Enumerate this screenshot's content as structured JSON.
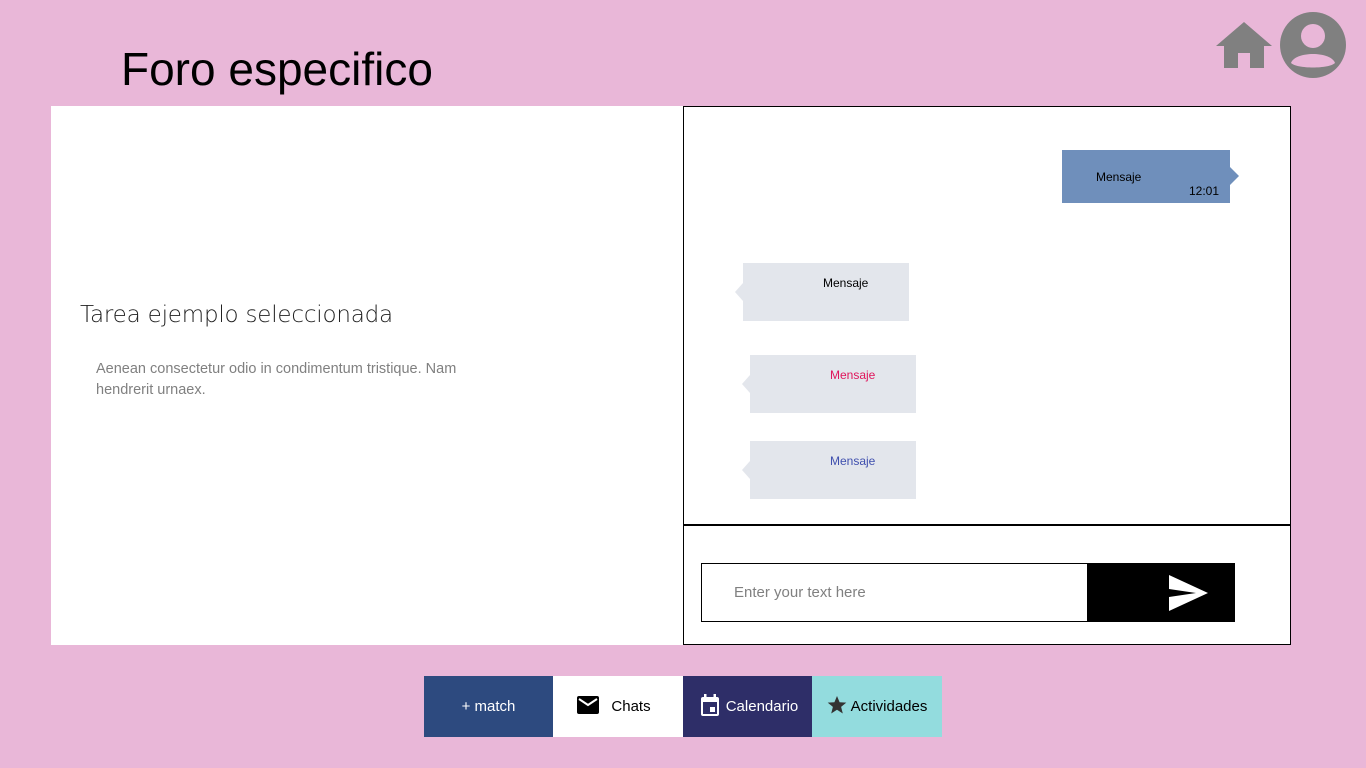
{
  "header": {
    "title": "Foro especifico",
    "icons": [
      "home-icon",
      "user-icon"
    ]
  },
  "task": {
    "title": "Tarea ejemplo seleccionada",
    "description": "Aenean consectetur odio in condimentum tristique. Nam hendrerit urnaex."
  },
  "chat": {
    "messages": [
      {
        "text": "Mensaje",
        "time": "12:01",
        "direction": "outgoing",
        "color": "#000000",
        "bg": "#6f8fbb"
      },
      {
        "text": "Mensaje",
        "direction": "incoming",
        "color": "#000000",
        "bg": "#e3e6ec"
      },
      {
        "text": "Mensaje",
        "direction": "incoming",
        "color": "#e0155b",
        "bg": "#e3e6ec"
      },
      {
        "text": "Mensaje",
        "direction": "incoming",
        "color": "#3f4fae",
        "bg": "#e3e6ec"
      }
    ],
    "input_placeholder": "Enter your text here",
    "input_value": "",
    "send_icon": "send-icon"
  },
  "nav": {
    "items": [
      {
        "label": "+ match",
        "icon": "",
        "bg": "#2d4a7f"
      },
      {
        "label": "Chats",
        "icon": "mail-icon",
        "bg": "#ffffff"
      },
      {
        "label": "Calendario",
        "icon": "calendar-icon",
        "bg": "#2e2e68"
      },
      {
        "label": "Actividades",
        "icon": "star-icon",
        "bg": "#93dcde"
      }
    ]
  },
  "colors": {
    "background": "#e9b7d8",
    "icon_gray": "#808080"
  }
}
